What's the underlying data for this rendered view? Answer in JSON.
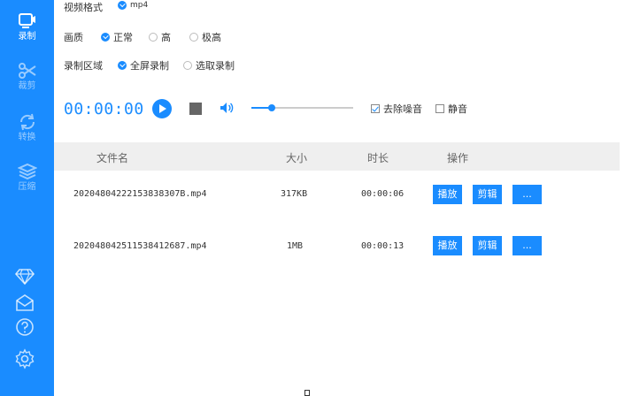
{
  "sidebar": {
    "items": [
      {
        "label": "录制",
        "icon": "record-icon"
      },
      {
        "label": "裁剪",
        "icon": "scissors-icon"
      },
      {
        "label": "转换",
        "icon": "convert-icon"
      },
      {
        "label": "压缩",
        "icon": "compress-icon"
      }
    ],
    "bottom_icons": [
      "diamond-icon",
      "mail-icon",
      "help-icon",
      "gear-icon"
    ]
  },
  "settings": {
    "format_label": "视频格式",
    "format_value": "mp4",
    "quality_label": "画质",
    "quality_options": [
      "正常",
      "高",
      "极高"
    ],
    "quality_selected": "正常",
    "area_label": "录制区域",
    "area_options": [
      "全屏录制",
      "选取录制"
    ],
    "area_selected": "全屏录制"
  },
  "controls": {
    "timer": "00:00:00",
    "volume_level": 0.2,
    "denoise_label": "去除噪音",
    "denoise_checked": true,
    "mute_label": "静音",
    "mute_checked": false
  },
  "table": {
    "headers": [
      "文件名",
      "大小",
      "时长",
      "操作"
    ],
    "rows": [
      {
        "name": "20204804222153838307B.mp4",
        "size": "317KB",
        "duration": "00:00:06"
      },
      {
        "name": "20204804251153841268​7.mp4",
        "size": "1MB",
        "duration": "00:00:13"
      }
    ],
    "actions": {
      "play": "播放",
      "edit": "剪辑",
      "more": "..."
    }
  },
  "colors": {
    "accent": "#1a8cff",
    "sidebar": "#1a8cff"
  }
}
